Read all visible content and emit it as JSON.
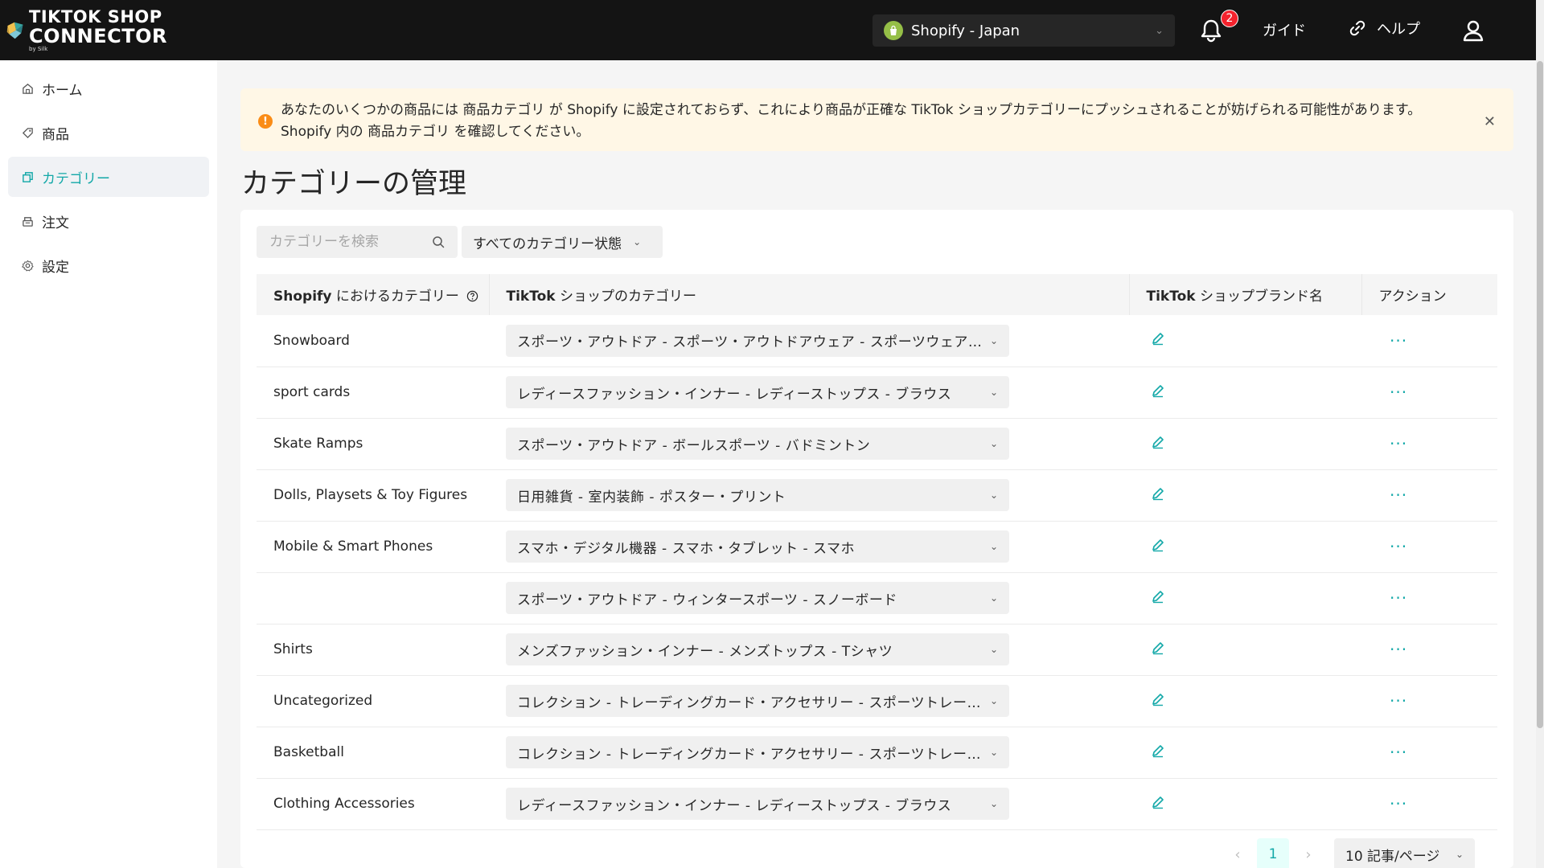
{
  "header": {
    "logo_line1": "TIKTOK SHOP",
    "logo_line2": "CONNECTOR",
    "logo_by": "by Silk",
    "store": "Shopify - Japan",
    "notification_count": "2",
    "guide": "ガイド",
    "help": "ヘルプ"
  },
  "sidebar": {
    "items": [
      {
        "label": "ホーム",
        "icon": "home-icon"
      },
      {
        "label": "商品",
        "icon": "tag-icon"
      },
      {
        "label": "カテゴリー",
        "icon": "category-icon"
      },
      {
        "label": "注文",
        "icon": "order-icon"
      },
      {
        "label": "設定",
        "icon": "settings-icon"
      }
    ],
    "active_index": 2
  },
  "alert": {
    "line1": "あなたのいくつかの商品には 商品カテゴリ が Shopify に設定されておらず、これにより商品が正確な TikTok ショップカテゴリーにプッシュされることが妨げられる可能性があります。",
    "line2": "Shopify 内の 商品カテゴリ を確認してください。"
  },
  "page": {
    "title": "カテゴリーの管理"
  },
  "toolbar": {
    "search_placeholder": "カテゴリーを検索",
    "filter_label": "すべてのカテゴリー状態"
  },
  "table": {
    "headers": {
      "shopify_bold": "Shopify",
      "shopify_rest": " におけるカテゴリー",
      "tiktok_bold": "TikTok",
      "tiktok_rest": " ショップのカテゴリー",
      "brand_bold": "TikTok",
      "brand_rest": " ショップブランド名",
      "action": "アクション"
    },
    "rows": [
      {
        "shopify": "Snowboard",
        "tiktok": "スポーツ・アウトドア - スポーツ・アウトドアウェア - スポーツウェア - スポーツウェア"
      },
      {
        "shopify": "sport cards",
        "tiktok": "レディースファッション・インナー - レディーストップス - ブラウス"
      },
      {
        "shopify": "Skate Ramps",
        "tiktok": "スポーツ・アウトドア - ボールスポーツ - バドミントン"
      },
      {
        "shopify": "Dolls, Playsets & Toy Figures",
        "tiktok": "日用雑貨 - 室内装飾 - ポスター・プリント"
      },
      {
        "shopify": "Mobile & Smart Phones",
        "tiktok": "スマホ・デジタル機器 - スマホ・タブレット - スマホ"
      },
      {
        "shopify": "",
        "tiktok": "スポーツ・アウトドア - ウィンタースポーツ - スノーボード"
      },
      {
        "shopify": "Shirts",
        "tiktok": "メンズファッション・インナー - メンズトップス - Tシャツ"
      },
      {
        "shopify": "Uncategorized",
        "tiktok": "コレクション - トレーディングカード・アクセサリー - スポーツトレーディングカード"
      },
      {
        "shopify": "Basketball",
        "tiktok": "コレクション - トレーディングカード・アクセサリー - スポーツトレーディングカード"
      },
      {
        "shopify": "Clothing Accessories",
        "tiktok": "レディースファッション・インナー - レディーストップス - ブラウス"
      }
    ]
  },
  "pagination": {
    "current_page": "1",
    "page_size": "10 記事/ページ"
  },
  "colors": {
    "accent": "#13a8a8",
    "header_bg": "#141414",
    "alert_bg": "#fff7e6",
    "alert_icon": "#fa8c16",
    "badge": "#f5222d"
  }
}
